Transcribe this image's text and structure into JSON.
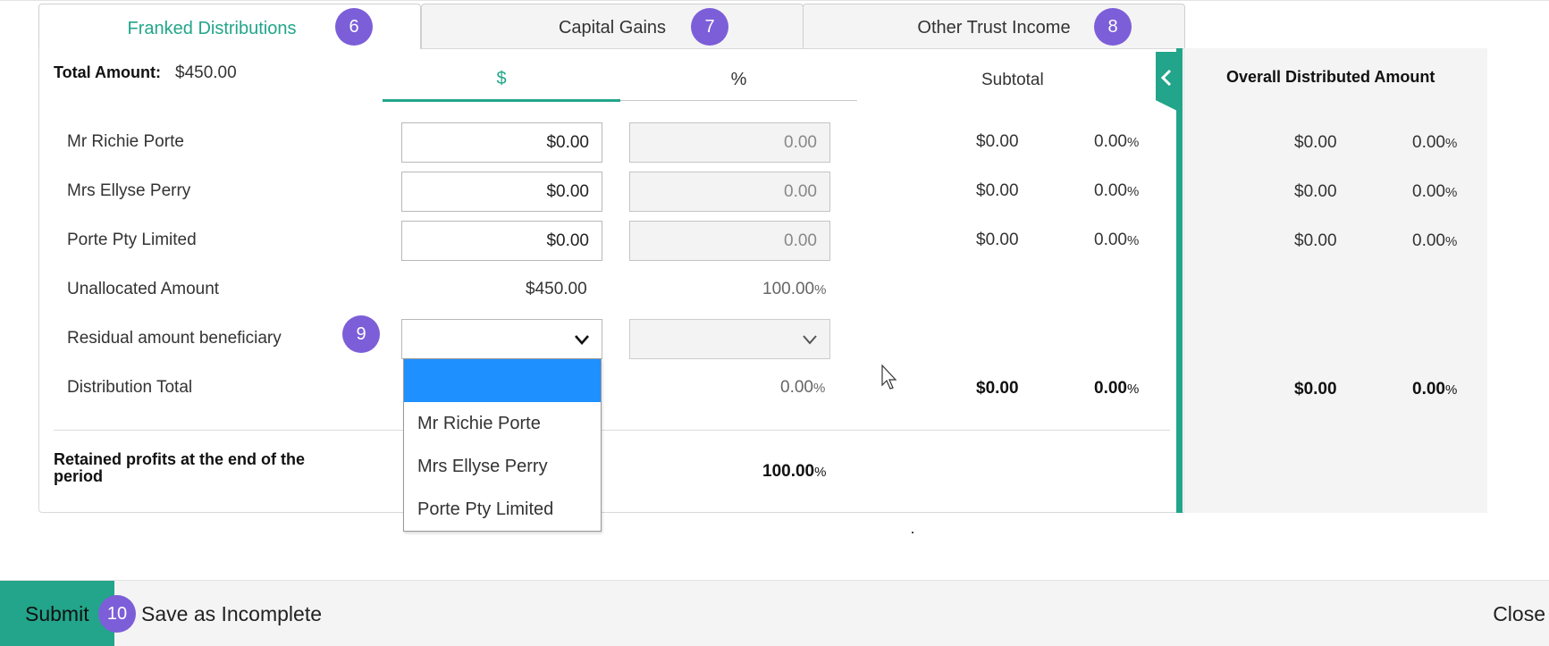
{
  "tabs": [
    {
      "label": "Franked Distributions",
      "badge": "6"
    },
    {
      "label": "Capital Gains",
      "badge": "7"
    },
    {
      "label": "Other Trust Income",
      "badge": "8"
    }
  ],
  "summary": {
    "total_label": "Total Amount:",
    "total_value": "$450.00"
  },
  "toggle": {
    "dollar": "$",
    "percent": "%"
  },
  "headers": {
    "subtotal": "Subtotal",
    "overall": "Overall Distributed Amount"
  },
  "beneficiaries": [
    {
      "name": "Mr Richie Porte",
      "amount": "$0.00",
      "percent": "0.00",
      "subtotal_amount": "$0.00",
      "subtotal_percent": "0.00",
      "overall_amount": "$0.00",
      "overall_percent": "0.00"
    },
    {
      "name": "Mrs Ellyse Perry",
      "amount": "$0.00",
      "percent": "0.00",
      "subtotal_amount": "$0.00",
      "subtotal_percent": "0.00",
      "overall_amount": "$0.00",
      "overall_percent": "0.00"
    },
    {
      "name": "Porte Pty Limited",
      "amount": "$0.00",
      "percent": "0.00",
      "subtotal_amount": "$0.00",
      "subtotal_percent": "0.00",
      "overall_amount": "$0.00",
      "overall_percent": "0.00"
    }
  ],
  "percent_sign": "%",
  "unallocated": {
    "label": "Unallocated Amount",
    "amount": "$450.00",
    "percent": "100.00"
  },
  "residual": {
    "label": "Residual amount beneficiary",
    "badge": "9",
    "selected": ""
  },
  "distribution_total": {
    "label": "Distribution Total",
    "percent": "0.00",
    "subtotal_amount": "$0.00",
    "subtotal_percent": "0.00",
    "overall_amount": "$0.00",
    "overall_percent": "0.00"
  },
  "retained": {
    "label_line1": "Retained profits at the end of the",
    "label_line2": "period",
    "percent": "100.00"
  },
  "dropdown_options": [
    "",
    "Mr Richie Porte",
    "Mrs Ellyse Perry",
    "Porte Pty Limited"
  ],
  "footer": {
    "submit": "Submit",
    "badge": "10",
    "save": "Save as Incomplete",
    "close": "Close"
  },
  "colors": {
    "accent": "#22a58a",
    "badge": "#7c5ed8",
    "dropdown_highlight": "#1e90ff"
  }
}
